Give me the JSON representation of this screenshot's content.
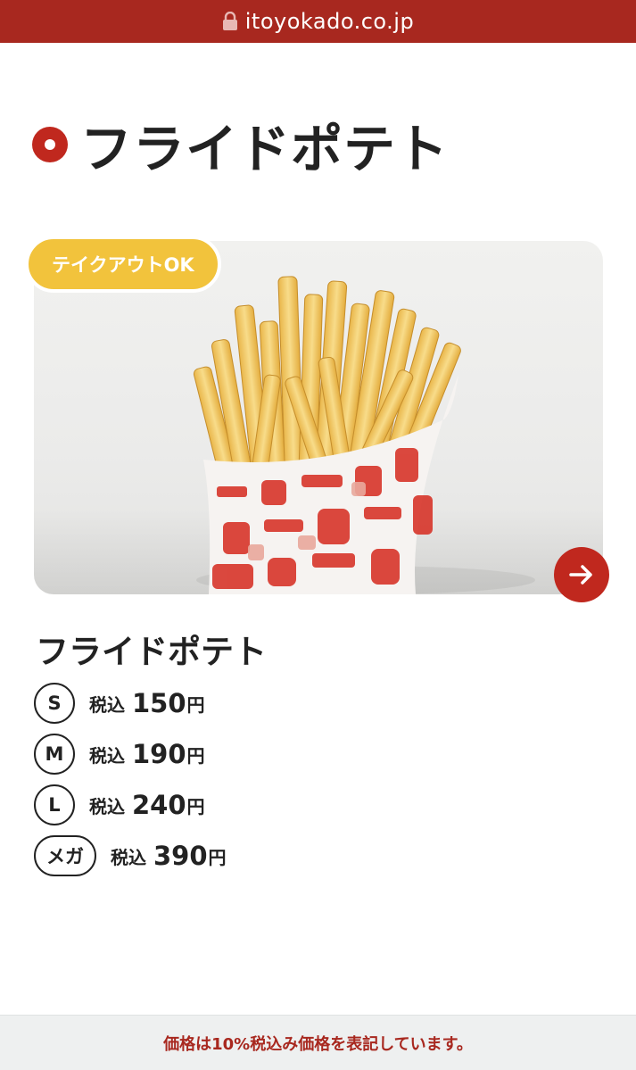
{
  "browser": {
    "url": "itoyokado.co.jp",
    "lock_icon": "lock-icon"
  },
  "page": {
    "title": "フライドポテト",
    "title_marker_icon": "circle-dot-icon"
  },
  "hero": {
    "badge_label": "テイクアウトOK",
    "next_icon": "arrow-right-icon",
    "image_subject": "french-fries"
  },
  "product": {
    "name": "フライドポテト",
    "sizes": [
      {
        "size": "S",
        "tax_label": "税込",
        "price": "150",
        "unit": "円"
      },
      {
        "size": "M",
        "tax_label": "税込",
        "price": "190",
        "unit": "円"
      },
      {
        "size": "L",
        "tax_label": "税込",
        "price": "240",
        "unit": "円"
      },
      {
        "size": "メガ",
        "tax_label": "税込",
        "price": "390",
        "unit": "円"
      }
    ]
  },
  "footer": {
    "note": "価格は10%税込み価格を表記しています。"
  },
  "colors": {
    "brand_red": "#a8281f",
    "accent_red": "#c0281e",
    "badge_yellow": "#f2c33c",
    "footer_bg": "#eef0f0"
  }
}
